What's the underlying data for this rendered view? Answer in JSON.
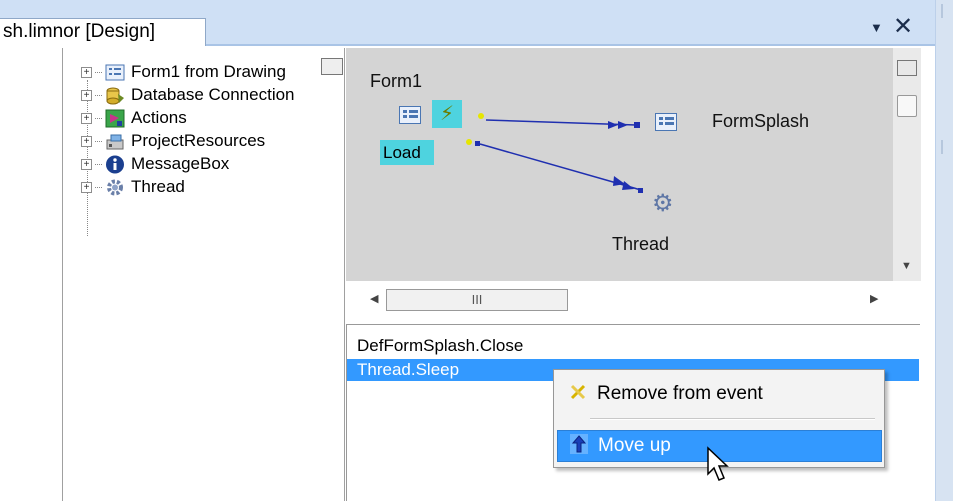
{
  "document_tab": {
    "title": "sh.limnor [Design]",
    "dropdown_icon": "dropdown-arrow-icon",
    "close_icon": "close-icon"
  },
  "object_tree": {
    "items": [
      {
        "label": "Form1 from Drawing",
        "icon": "form-icon",
        "expander": "+"
      },
      {
        "label": "Database Connection",
        "icon": "database-icon",
        "expander": "+"
      },
      {
        "label": "Actions",
        "icon": "actions-icon",
        "expander": "+"
      },
      {
        "label": "ProjectResources",
        "icon": "resources-icon",
        "expander": "+"
      },
      {
        "label": "MessageBox",
        "icon": "info-icon",
        "expander": "+"
      },
      {
        "label": "Thread",
        "icon": "gear-icon",
        "expander": "+"
      }
    ]
  },
  "diagram": {
    "form_label": "Form1",
    "event_label": "Load",
    "target_form_label": "FormSplash",
    "target_thread_label": "Thread",
    "hscroll_grip": "III",
    "colors": {
      "canvas": "#d4d4d4",
      "event_highlight": "#4ed3df",
      "link_line": "#1f2fb0"
    }
  },
  "action_list": {
    "items": [
      {
        "label": "DefFormSplash.Close",
        "selected": false
      },
      {
        "label": "Thread.Sleep",
        "selected": true
      }
    ],
    "selection_color": "#3399ff"
  },
  "context_menu": {
    "items": [
      {
        "label": "Remove from event",
        "icon": "remove-icon",
        "hovered": false
      },
      {
        "label": "Move up",
        "icon": "move-up-icon",
        "hovered": true
      }
    ]
  }
}
